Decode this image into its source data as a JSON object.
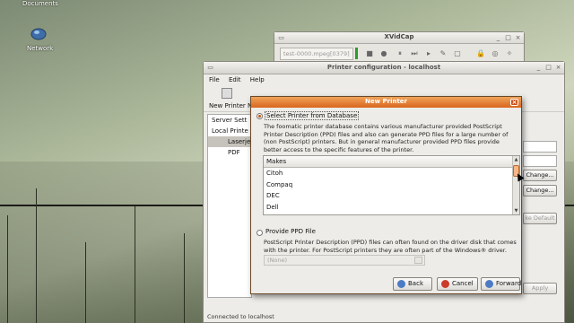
{
  "desktop": {
    "top_label": "Documents",
    "network_label": "Network"
  },
  "xvidcap": {
    "title": "XVidCap",
    "file_field": "test-0000.mpeg[0379]"
  },
  "printer_config": {
    "title": "Printer configuration - localhost",
    "menu": [
      "File",
      "Edit",
      "Help"
    ],
    "toolbar_new": "New Printer",
    "toolbar_n": "N",
    "tree": [
      "Server Sett",
      "Local Printe",
      "Laserjet",
      "PDF"
    ],
    "change_button": "Change...",
    "make_default_button": "ke Default",
    "apply_button": "Apply",
    "status": "Connected to localhost"
  },
  "new_printer": {
    "title": "New Printer",
    "option_database": "Select Printer from Database",
    "database_desc": "The foomatic printer database contains various manufacturer provided PostScript Printer Description (PPD) files and also can generate PPD files for a large number of (non PostScript) printers. But in general manufacturer provided PPD files provide better access to the specific features of the printer.",
    "makes_header": "Makes",
    "makes": [
      "Citoh",
      "Compaq",
      "DEC",
      "Dell"
    ],
    "option_ppd": "Provide PPD File",
    "ppd_desc": "PostScript Printer Description (PPD) files can often found on the driver disk that comes with the printer. For PostScript printers they are often part of the Windows® driver.",
    "ppd_placeholder": "(None)",
    "back_button": "Back",
    "cancel_button": "Cancel",
    "forward_button": "Forward",
    "colors": {
      "title_bar": "#e0742a",
      "accent": "#c8500e"
    }
  }
}
